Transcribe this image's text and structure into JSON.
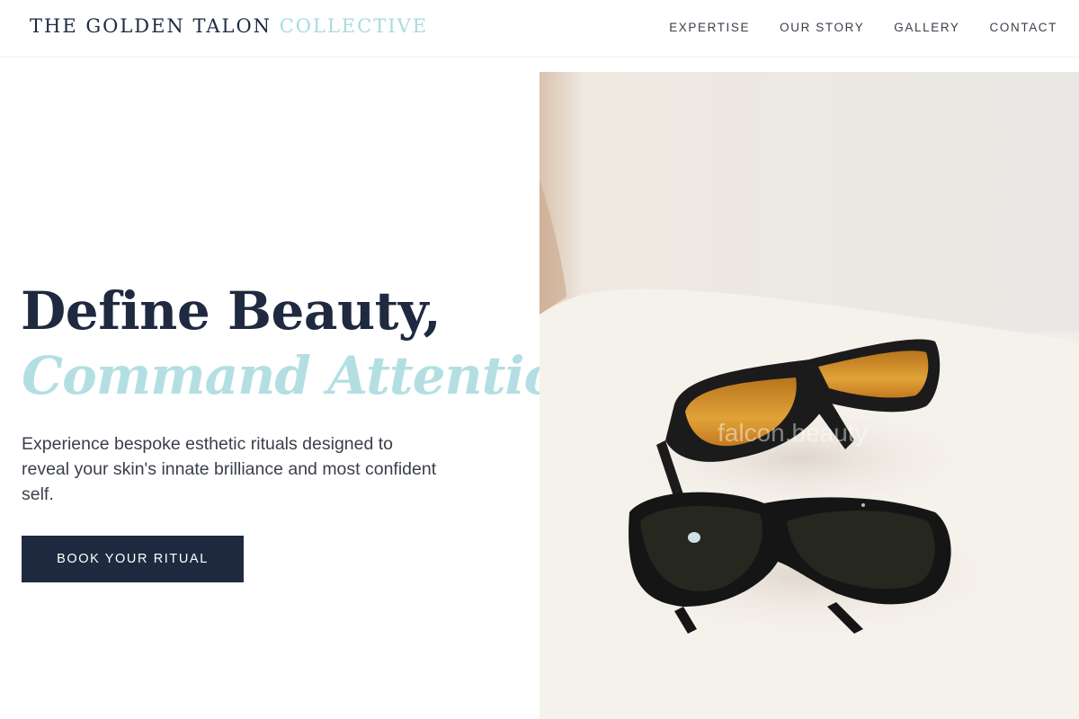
{
  "header": {
    "brand_main": "THE GOLDEN TALON",
    "brand_accent": "COLLECTIVE",
    "nav": [
      {
        "label": "EXPERTISE"
      },
      {
        "label": "OUR STORY"
      },
      {
        "label": "GALLERY"
      },
      {
        "label": "CONTACT"
      }
    ]
  },
  "hero": {
    "headline_line1": "Define Beauty,",
    "headline_line2": "Command Attention.",
    "subtext": "Experience bespoke esthetic rituals designed to reveal your skin's innate brilliance and most confident self.",
    "cta_label": "BOOK YOUR RITUAL",
    "image": {
      "subject": "two pairs of protective laser safety glasses (amber and dark lenses) on a white surface",
      "watermark": "falcon.beauty"
    }
  },
  "colors": {
    "navy": "#1f2a40",
    "accent_light_blue": "#a9dbe0",
    "text_gray": "#3a3f4a",
    "background": "#ffffff"
  }
}
